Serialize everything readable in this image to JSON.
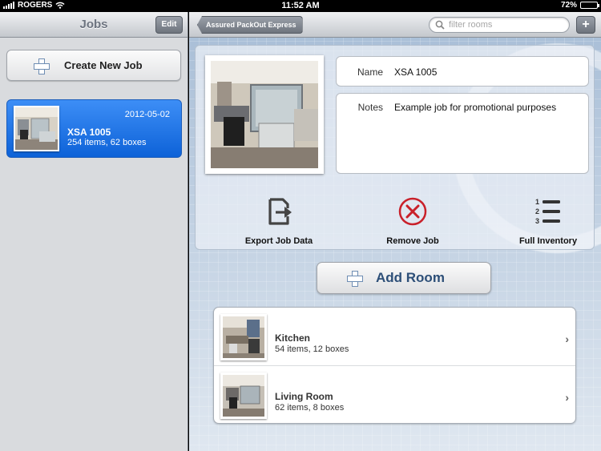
{
  "status_bar": {
    "carrier": "ROGERS",
    "time": "11:52 AM",
    "battery": "72%",
    "battery_level": 0.72
  },
  "jobs_pane": {
    "title": "Jobs",
    "edit_label": "Edit",
    "create_label": "Create New Job",
    "jobs": [
      {
        "date": "2012-05-02",
        "name": "XSA 1005",
        "summary": "254 items, 62 boxes"
      }
    ]
  },
  "job_detail": {
    "back_label": "Assured PackOut Express",
    "search_placeholder": "filter rooms",
    "add_label": "+",
    "name_label": "Name",
    "name_value": "XSA 1005",
    "notes_label": "Notes",
    "notes_value": "Example job for promotional purposes",
    "actions": {
      "export": "Export Job Data",
      "remove": "Remove Job",
      "inventory": "Full Inventory"
    },
    "inventory_numbers": [
      "1",
      "2",
      "3"
    ],
    "add_room_label": "Add Room",
    "rooms": [
      {
        "name": "Kitchen",
        "summary": "54 items, 12 boxes",
        "chevron": "›"
      },
      {
        "name": "Living Room",
        "summary": "62 items, 8 boxes",
        "chevron": "›"
      }
    ]
  },
  "colors": {
    "selected_job": "#1a6fe0",
    "remove_red": "#c9202a",
    "add_room_text": "#2d4f78"
  },
  "icons": {
    "wifi": "wifi-icon",
    "battery": "battery-icon",
    "plus": "plus-icon",
    "search": "search-icon",
    "export": "export-icon",
    "remove": "remove-icon",
    "inventory": "inventory-list-icon",
    "chevron": "chevron-right-icon"
  }
}
